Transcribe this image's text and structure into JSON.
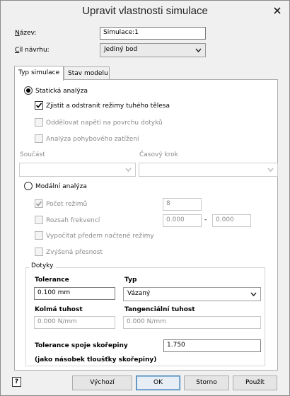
{
  "window": {
    "title": "Upravit vlastnosti simulace"
  },
  "header": {
    "name_label": "Název:",
    "name_value": "Simulace:1",
    "target_label": "Cíl návrhu:",
    "target_value": "Jediný bod"
  },
  "tabs": [
    {
      "label": "Typ simulace",
      "active": true
    },
    {
      "label": "Stav modelu",
      "active": false
    }
  ],
  "static": {
    "radio_label": "Statická analýza",
    "selected": true,
    "options": [
      {
        "label": "Zjistit a odstranit režimy tuhého tělesa",
        "checked": true,
        "enabled": true
      },
      {
        "label": "Oddělovat napětí na povrchu dotyků",
        "checked": false,
        "enabled": false
      },
      {
        "label": "Analýza pohybového zatížení",
        "checked": false,
        "enabled": false
      }
    ],
    "part_label": "Součást",
    "part_value": "",
    "timestep_label": "Časový krok",
    "timestep_value": ""
  },
  "modal": {
    "radio_label": "Modální analýza",
    "selected": false,
    "mode_count_label": "Počet režimů",
    "mode_count_checked": true,
    "mode_count_value": "8",
    "freq_range_label": "Rozsah frekvencí",
    "freq_from": "0.000",
    "freq_sep": "-",
    "freq_to": "0.000",
    "precompute_label": "Vypočítat předem načtené režimy",
    "precision_label": "Zvýšená přesnost"
  },
  "contacts": {
    "title": "Dotyky",
    "tolerance_label": "Tolerance",
    "tolerance_value": "0.100 mm",
    "type_label": "Typ",
    "type_value": "Vázaný",
    "normal_stiffness_label": "Kolmá tuhost",
    "normal_stiffness_value": "0.000 N/mm",
    "tangential_stiffness_label": "Tangenciální tuhost",
    "tangential_stiffness_value": "0.000 N/mm",
    "shell_tolerance_label": "Tolerance spoje skořepiny",
    "shell_tolerance_value": "1.750",
    "shell_tolerance_note": "(jako násobek tloušťky skořepiny)"
  },
  "footer": {
    "help_glyph": "?",
    "default_label": "Výchozí",
    "ok_label": "OK",
    "cancel_label": "Storno",
    "apply_label": "Použít"
  },
  "colors": {
    "window_bg": "#f0f0f0",
    "panel_bg": "#ffffff",
    "default_button_border": "#3c7fb1",
    "disabled_text": "#8b8b8b"
  }
}
